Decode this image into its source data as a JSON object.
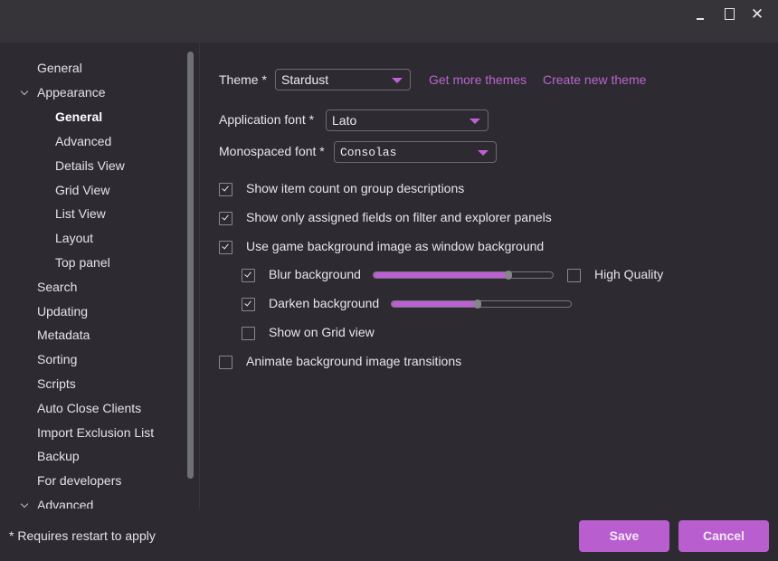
{
  "window": {
    "controls": {
      "minimize": "minimize-icon",
      "maximize": "maximize-icon",
      "close": "✕"
    }
  },
  "sidebar": {
    "items": [
      {
        "label": "General",
        "level": 1
      },
      {
        "label": "Appearance",
        "level": 1,
        "expanded": true
      },
      {
        "label": "General",
        "level": 2,
        "active": true
      },
      {
        "label": "Advanced",
        "level": 2
      },
      {
        "label": "Details View",
        "level": 2
      },
      {
        "label": "Grid View",
        "level": 2
      },
      {
        "label": "List View",
        "level": 2
      },
      {
        "label": "Layout",
        "level": 2
      },
      {
        "label": "Top panel",
        "level": 2
      },
      {
        "label": "Search",
        "level": 1
      },
      {
        "label": "Updating",
        "level": 1
      },
      {
        "label": "Metadata",
        "level": 1
      },
      {
        "label": "Sorting",
        "level": 1
      },
      {
        "label": "Scripts",
        "level": 1
      },
      {
        "label": "Auto Close Clients",
        "level": 1
      },
      {
        "label": "Import Exclusion List",
        "level": 1
      },
      {
        "label": "Backup",
        "level": 1
      },
      {
        "label": "For developers",
        "level": 1
      },
      {
        "label": "Advanced",
        "level": 1,
        "expanded": true
      }
    ]
  },
  "main": {
    "theme": {
      "label": "Theme *",
      "value": "Stardust",
      "get_more": "Get more themes",
      "create_new": "Create new theme"
    },
    "app_font": {
      "label": "Application font *",
      "value": "Lato"
    },
    "mono_font": {
      "label": "Monospaced font *",
      "value": "Consolas"
    },
    "options": [
      {
        "label": "Show item count on group descriptions",
        "checked": true
      },
      {
        "label": "Show only assigned fields on filter and explorer panels",
        "checked": true
      },
      {
        "label": "Use game background image as window background",
        "checked": true
      }
    ],
    "blur": {
      "label": "Blur background",
      "checked": true,
      "value": 0.75,
      "high_quality_label": "High Quality",
      "high_quality_checked": false
    },
    "darken": {
      "label": "Darken background",
      "checked": true,
      "value": 0.48
    },
    "show_on_grid": {
      "label": "Show on Grid view",
      "checked": false
    },
    "animate": {
      "label": "Animate background image transitions",
      "checked": false
    }
  },
  "footer": {
    "note": "* Requires restart to apply",
    "save": "Save",
    "cancel": "Cancel"
  },
  "colors": {
    "accent": "#b85ecf",
    "background": "#2d2b31",
    "titlebar": "#363439"
  }
}
